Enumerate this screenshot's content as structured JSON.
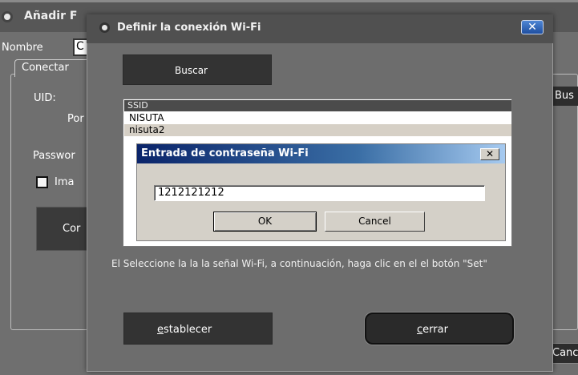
{
  "background_window": {
    "title": "Añadir F",
    "name_label": "Nombre",
    "name_value": "C",
    "tab_label": "Conectar",
    "uid_label": "UID:",
    "port_label": "Por",
    "password_label": "Passwor",
    "checkbox_label": "Ima",
    "connect_label": "Cor",
    "search_label": "Bus",
    "cancel_label": "Canc"
  },
  "wifi_dialog": {
    "title": "Definir la conexión Wi-Fi",
    "close_glyph": "✕",
    "search_label": "Buscar",
    "list": {
      "header": "SSID",
      "items": [
        "NISUTA",
        "nisuta2"
      ],
      "selected_index": 1
    },
    "instruction": "El Seleccione la la la señal Wi-Fi, a continuación, haga clic en el el botón \"Set\"",
    "set_label": "establecer",
    "close_label": "cerrar"
  },
  "password_dialog": {
    "title": "Entrada de contraseña Wi-Fi",
    "close_glyph": "✕",
    "input_value": "1212121212",
    "ok_label": "OK",
    "cancel_label": "Cancel"
  },
  "colors": {
    "background": "#6f6f6f",
    "dialog_bg": "#6d6d6d",
    "button_dark": "#333333",
    "selection": "#d6d0c6",
    "win_titlebar_start": "#0a246a",
    "win_titlebar_end": "#a6caf0",
    "win_face": "#d4d0c8"
  },
  "icons": {
    "window_icon": "radio-dot-icon",
    "close": "close-icon"
  }
}
